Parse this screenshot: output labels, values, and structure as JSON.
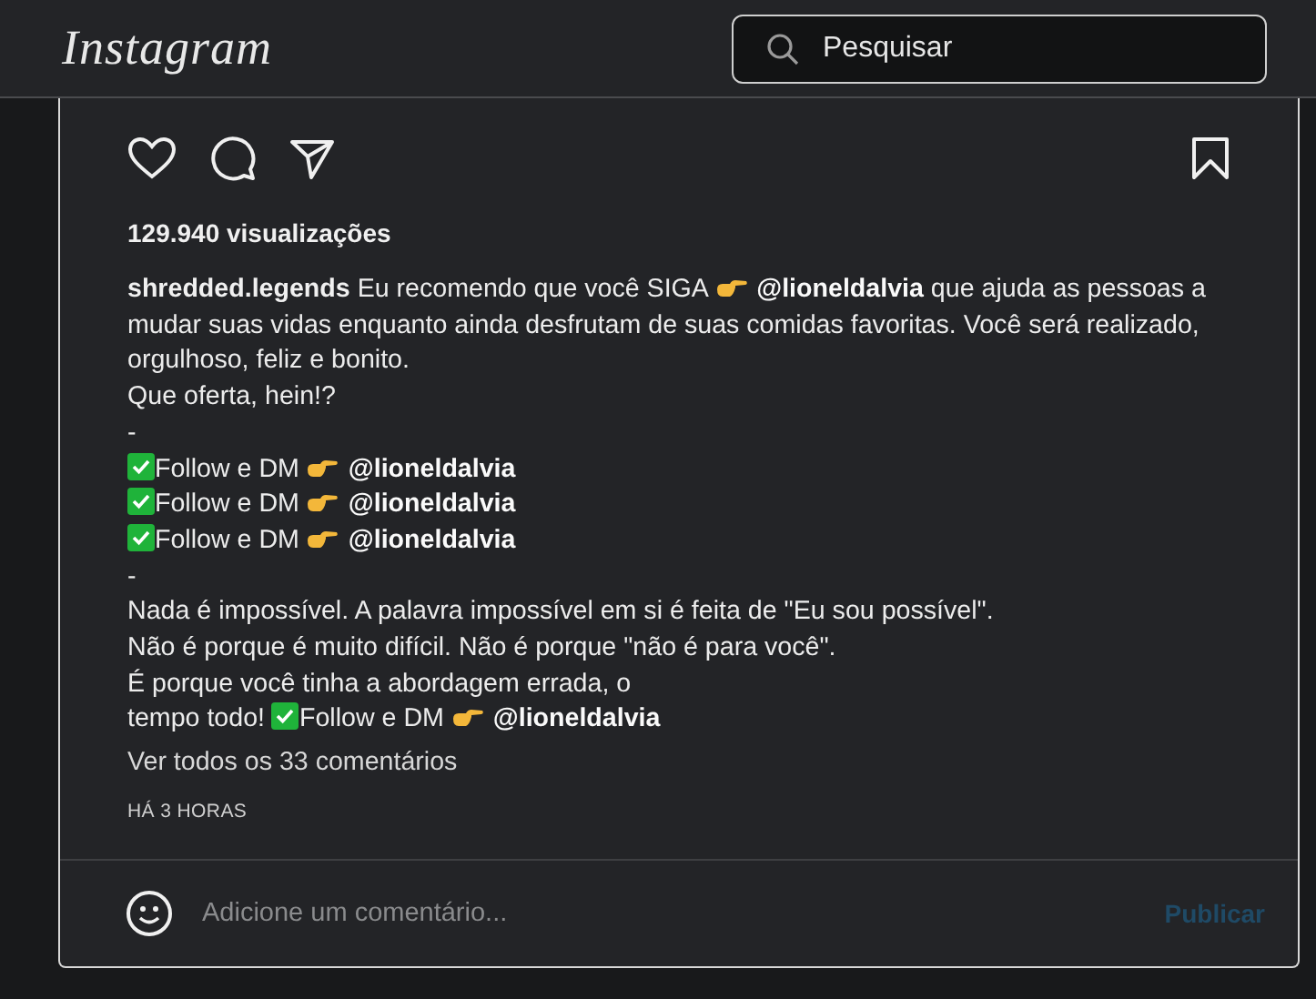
{
  "header": {
    "logo": "Instagram",
    "search": {
      "placeholder": "Pesquisar"
    }
  },
  "post": {
    "views": "129.940 visualizações",
    "caption": [
      {
        "kind": "username",
        "text": "shredded.legends"
      },
      {
        "kind": "text",
        "text": " Eu recomendo que você SIGA "
      },
      {
        "kind": "hand"
      },
      {
        "kind": "mention",
        "text": "@lioneldalvia"
      },
      {
        "kind": "text",
        "text": " que ajuda as pessoas a mudar suas vidas enquanto ainda desfrutam de suas comidas favoritas. Você será realizado, orgulhoso, feliz e bonito.\nQue oferta, hein!?\n-\n"
      },
      {
        "kind": "check"
      },
      {
        "kind": "text",
        "text": "Follow e DM "
      },
      {
        "kind": "hand"
      },
      {
        "kind": "mention",
        "text": "@lioneldalvia"
      },
      {
        "kind": "break"
      },
      {
        "kind": "check"
      },
      {
        "kind": "text",
        "text": "Follow e DM "
      },
      {
        "kind": "hand"
      },
      {
        "kind": "mention",
        "text": "@lioneldalvia"
      },
      {
        "kind": "break"
      },
      {
        "kind": "check"
      },
      {
        "kind": "text",
        "text": "Follow e DM "
      },
      {
        "kind": "hand"
      },
      {
        "kind": "mention",
        "text": "@lioneldalvia"
      },
      {
        "kind": "text",
        "text": "\n-\nNada é impossível. A palavra impossível em si é feita de \"Eu sou possível\".\nNão é porque é muito difícil. Não é porque \"não é para você\".\nÉ porque você tinha a abordagem errada, o\ntempo todo! "
      },
      {
        "kind": "check"
      },
      {
        "kind": "text",
        "text": "Follow e DM "
      },
      {
        "kind": "hand"
      },
      {
        "kind": "mention",
        "text": "@lioneldalvia"
      }
    ],
    "comments_link": "Ver todos os 33 comentários",
    "time": "HÁ 3 HORAS",
    "comment_box": {
      "placeholder": "Adicione um comentário...",
      "submit": "Publicar",
      "submit_disabled": true
    }
  }
}
